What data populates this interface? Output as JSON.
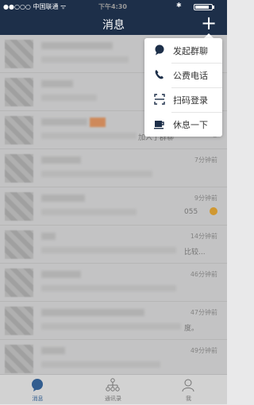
{
  "status_bar": {
    "carrier": "●●○○○ 中国联通 ᯤ",
    "time": "下午4:30",
    "bluetooth": "✱"
  },
  "nav": {
    "title": "消息",
    "add_button": "+"
  },
  "menu": {
    "items": [
      {
        "label": "发起群聊",
        "icon": "chat-bubble-icon"
      },
      {
        "label": "公费电话",
        "icon": "phone-icon"
      },
      {
        "label": "扫码登录",
        "icon": "scan-icon"
      },
      {
        "label": "休息一下",
        "icon": "coffee-cup-icon"
      }
    ]
  },
  "conversations": [
    {
      "time": "",
      "tail": ""
    },
    {
      "time": "",
      "tail": ""
    },
    {
      "time": "",
      "tail": "加入了群聊"
    },
    {
      "time": "7分钟前",
      "tail": ""
    },
    {
      "time": "9分钟前",
      "tail": "055"
    },
    {
      "time": "14分钟前",
      "tail": "比较..."
    },
    {
      "time": "46分钟前",
      "tail": ""
    },
    {
      "time": "47分钟前",
      "tail": "度。"
    },
    {
      "time": "49分钟前",
      "tail": ""
    }
  ],
  "tabs": [
    {
      "label": "消息",
      "icon": "chat-bubble-icon"
    },
    {
      "label": "通讯录",
      "icon": "org-chart-icon"
    },
    {
      "label": "我",
      "icon": "person-icon"
    }
  ],
  "colors": {
    "header": "#1d2f49",
    "accent": "#3b6ea8"
  }
}
